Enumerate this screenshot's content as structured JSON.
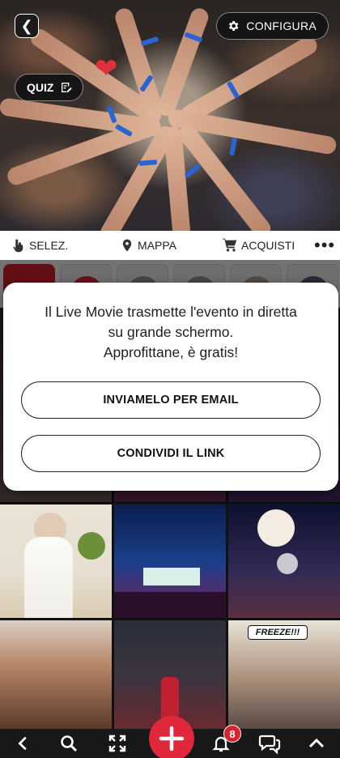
{
  "header": {
    "config_label": "CONFIGURA",
    "quiz_label": "QUIZ"
  },
  "toolbar": {
    "select_label": "SELEZ.",
    "map_label": "MAPPA",
    "purchases_label": "ACQUISTI"
  },
  "modal": {
    "message_lines": [
      "Il Live Movie trasmette l'evento in diretta",
      "su grande schermo.",
      "Approfittane, è gratis!"
    ],
    "email_button": "INVIAMELO PER EMAIL",
    "share_button": "CONDIVIDI IL LINK"
  },
  "grid": {
    "freeze_sign": "FREEZE!!!"
  },
  "bottom_bar": {
    "notification_count": "8"
  },
  "colors": {
    "accent": "#e0283a",
    "band": "#2a63d4"
  }
}
